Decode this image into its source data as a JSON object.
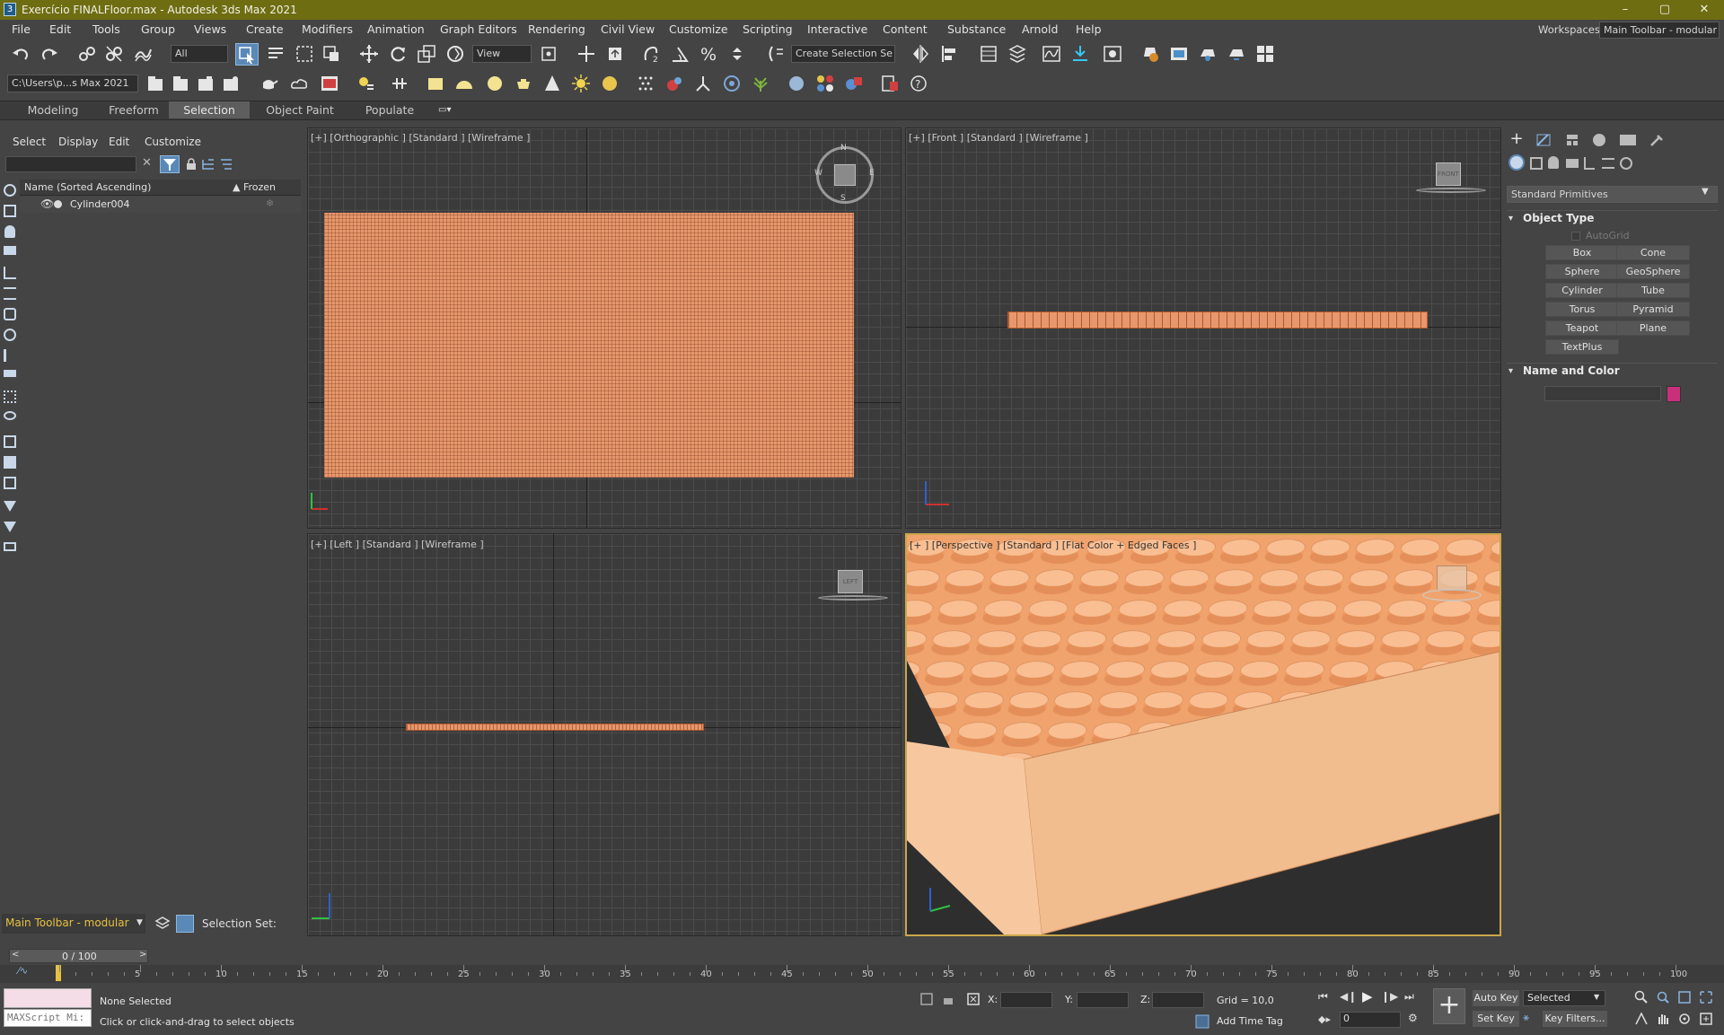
{
  "titlebar": {
    "title": "Exercício FINALFloor.max - Autodesk 3ds Max 2021",
    "minimize": "–",
    "restore": "▢",
    "close": "✕"
  },
  "menu": {
    "items": [
      "File",
      "Edit",
      "Tools",
      "Group",
      "Views",
      "Create",
      "Modifiers",
      "Animation",
      "Graph Editors",
      "Rendering",
      "Civil View",
      "Customize",
      "Scripting",
      "Interactive",
      "Content",
      "Substance",
      "Arnold",
      "Help"
    ],
    "workspaces_label": "Workspaces:",
    "workspaces_value": "Main Toolbar - modular"
  },
  "toolbar": {
    "filter_value": "All",
    "view_value": "View",
    "create_selection_set": "Create Selection Se"
  },
  "toolbar2": {
    "path_value": "C:\\Users\\p...s Max 2021"
  },
  "ribbon": {
    "tabs": [
      "Modeling",
      "Freeform",
      "Selection",
      "Object Paint",
      "Populate"
    ],
    "active_tab": "Selection"
  },
  "scene_explorer": {
    "menu": [
      "Select",
      "Display",
      "Edit",
      "Customize"
    ],
    "search_value": "",
    "col_name": "Name (Sorted Ascending)",
    "col_frozen": "▲ Frozen",
    "rows": [
      {
        "name": "Cylinder004"
      }
    ]
  },
  "viewports": {
    "top_left": "[+] [Orthographic ] [Standard ] [Wireframe ]",
    "top_right": "[+] [Front ] [Standard ] [Wireframe ]",
    "bottom_left": "[+] [Left ] [Standard ] [Wireframe ]",
    "bottom_right": "[+ ] [Perspective ] [Standard ] [Flat Color + Edged Faces ]",
    "viewcube_front": "FRONT",
    "viewcube_left": "LEFT",
    "compass_n": "N",
    "compass_s": "S",
    "compass_e": "E",
    "compass_w": "W"
  },
  "command_panel": {
    "category": "Standard Primitives",
    "object_type_title": "Object Type",
    "autogrid": "AutoGrid",
    "buttons": [
      "Box",
      "Cone",
      "Sphere",
      "GeoSphere",
      "Cylinder",
      "Tube",
      "Torus",
      "Pyramid",
      "Teapot",
      "Plane",
      "TextPlus"
    ],
    "name_color_title": "Name and Color",
    "name_value": "",
    "object_color": "#c8307a"
  },
  "bottom_left": {
    "workspace_label": "Main Toolbar - modular",
    "selection_set_label": "Selection Set:"
  },
  "timeline": {
    "frame_display": "0 / 100",
    "ticks": [
      "5",
      "10",
      "15",
      "20",
      "25",
      "30",
      "35",
      "40",
      "45",
      "50",
      "55",
      "60",
      "65",
      "70",
      "75",
      "80",
      "85",
      "90",
      "95",
      "100"
    ]
  },
  "status": {
    "maxscript": "MAXScript Mi:",
    "none_selected": "None Selected",
    "prompt": "Click or click-and-drag to select objects",
    "x_label": "X:",
    "y_label": "Y:",
    "z_label": "Z:",
    "grid": "Grid = 10,0",
    "add_time_tag": "Add Time Tag",
    "auto_key": "Auto Key",
    "selected": "Selected",
    "set_key": "Set Key",
    "key_filters": "Key Filters...",
    "frame_value": "0"
  },
  "colors": {
    "title_bar": "#6f6d12",
    "object_orange": "#e8976c",
    "perspective_fill": "#f4b98a",
    "active_accent": "#4d8fd1"
  }
}
